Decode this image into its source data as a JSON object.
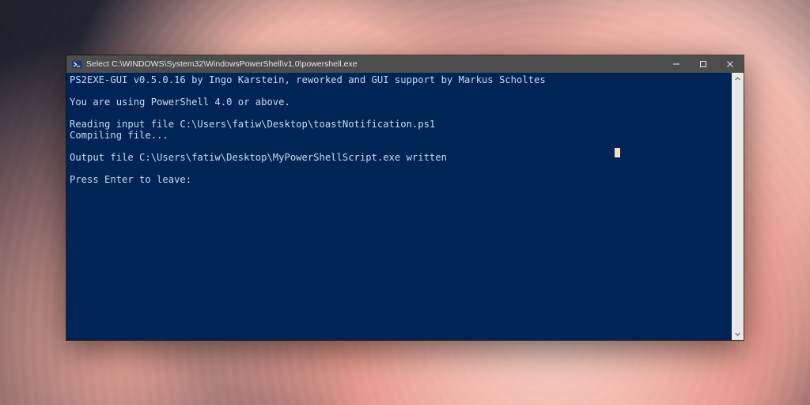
{
  "window": {
    "title": "Select C:\\WINDOWS\\System32\\WindowsPowerShell\\v1.0\\powershell.exe"
  },
  "console": {
    "lines": [
      "PS2EXE-GUI v0.5.0.16 by Ingo Karstein, reworked and GUI support by Markus Scholtes",
      "",
      "You are using PowerShell 4.0 or above.",
      "",
      "Reading input file C:\\Users\\fatiw\\Desktop\\toastNotification.ps1",
      "Compiling file...",
      "",
      "Output file C:\\Users\\fatiw\\Desktop\\MyPowerShellScript.exe written",
      "",
      "Press Enter to leave:"
    ]
  },
  "colors": {
    "console_bg": "#012456",
    "console_fg": "#c8d9ef",
    "titlebar_bg": "#4d4d4d",
    "caret": "#f3e0c2"
  }
}
